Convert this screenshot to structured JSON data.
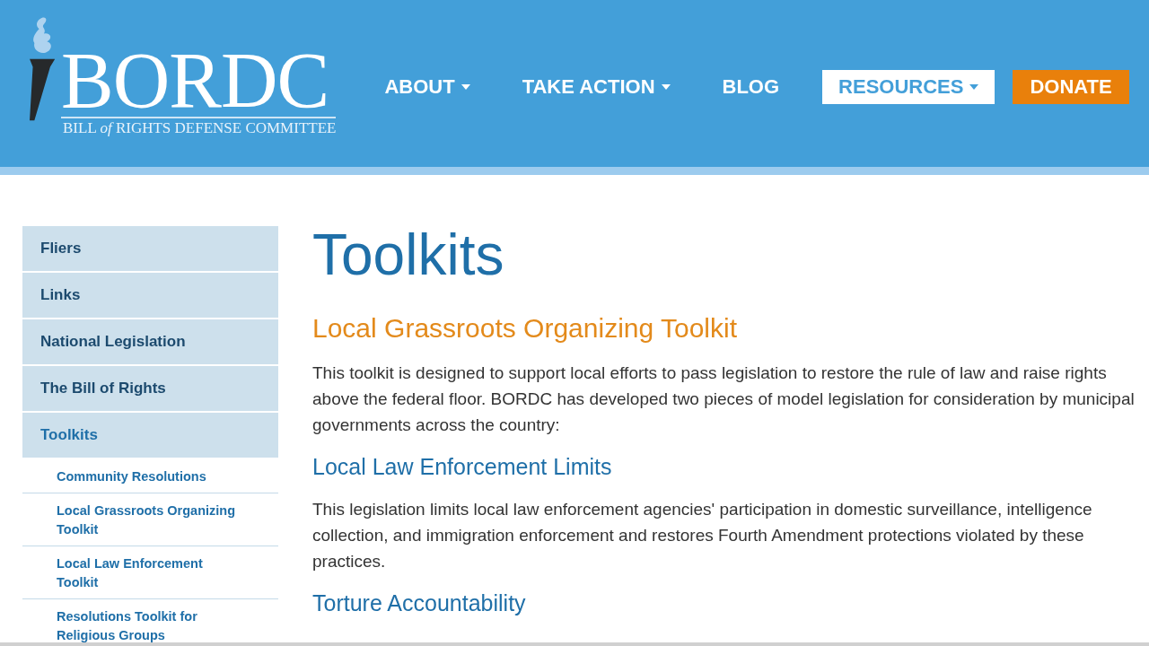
{
  "header": {
    "logo": {
      "name": "BORDC",
      "tagline": "BILL *of* RIGHTS DEFENSE COMMITTEE"
    },
    "nav": [
      {
        "label": "ABOUT",
        "kind": "link",
        "dropdown": true,
        "selected": false
      },
      {
        "label": "TAKE ACTION",
        "kind": "link",
        "dropdown": true,
        "selected": false
      },
      {
        "label": "BLOG",
        "kind": "link",
        "dropdown": false,
        "selected": false
      },
      {
        "label": "RESOURCES",
        "kind": "link",
        "dropdown": true,
        "selected": true
      },
      {
        "label": "DONATE",
        "kind": "donate",
        "dropdown": false,
        "selected": false
      }
    ]
  },
  "sidebar": {
    "items": [
      {
        "label": "Fliers",
        "selected": false
      },
      {
        "label": "Links",
        "selected": false
      },
      {
        "label": "National Legislation",
        "selected": false
      },
      {
        "label": "The Bill of Rights",
        "selected": false
      },
      {
        "label": "Toolkits",
        "selected": true,
        "children": [
          {
            "label": "Community Resolutions"
          },
          {
            "label": "Local Grassroots Organizing Toolkit"
          },
          {
            "label": "Local Law Enforcement Toolkit"
          },
          {
            "label": "Resolutions Toolkit for Religious Groups"
          }
        ]
      }
    ]
  },
  "content": {
    "title": "Toolkits",
    "blocks": [
      {
        "kind": "heading",
        "text": "Local Grassroots Organizing Toolkit"
      },
      {
        "kind": "paragraph",
        "text": "This toolkit is designed to support local efforts to pass legislation to restore the rule of law and raise rights above the federal floor. BORDC has developed two pieces of model legislation for consideration by municipal governments across the country:"
      },
      {
        "kind": "subheading",
        "text": "Local Law Enforcement Limits"
      },
      {
        "kind": "paragraph",
        "text": "This legislation limits local law enforcement agencies' participation in domestic surveillance, intelligence collection, and immigration enforcement and restores Fourth Amendment protections violated by these practices."
      },
      {
        "kind": "subheading",
        "text": "Torture Accountability"
      }
    ]
  }
}
